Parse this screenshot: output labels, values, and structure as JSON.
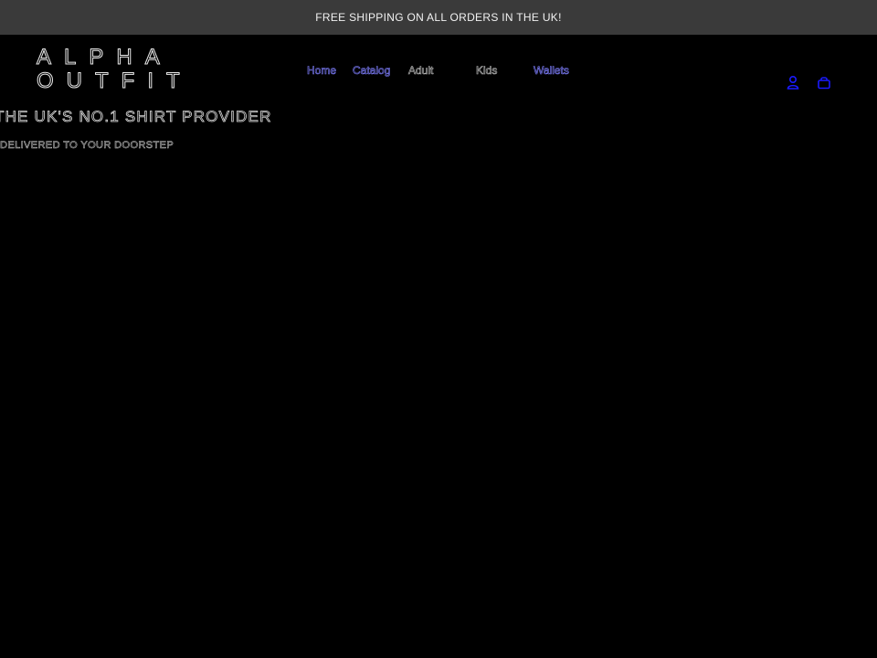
{
  "announcement": {
    "text": "FREE SHIPPING ON ALL ORDERS IN THE UK!"
  },
  "header": {
    "logo_text": "ALPHA\nOUTFIT",
    "nav": {
      "home": "Home",
      "catalog": "Catalog",
      "adult": "Adult",
      "kids": "Kids",
      "wallets": "Wallets"
    },
    "icons": {
      "account": "account-icon",
      "cart": "cart-icon"
    }
  },
  "hero": {
    "title": "THE UK'S NO.1 SHIRT PROVIDER",
    "subtitle": "DELIVERED TO YOUR DOORSTEP"
  },
  "colors": {
    "background": "#000000",
    "announcement_bg": "#3a3a3a",
    "link": "#7f7fff",
    "icon": "#1a1aff"
  }
}
